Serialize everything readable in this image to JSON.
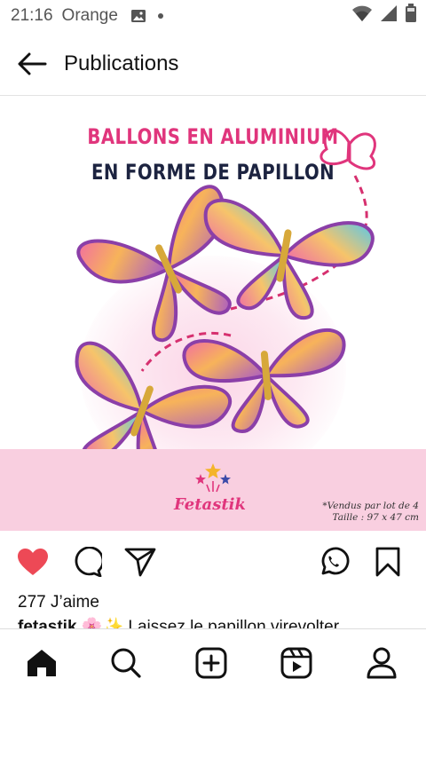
{
  "status_bar": {
    "time": "21:16",
    "carrier": "Orange",
    "icons": [
      "image-icon",
      "dot-icon",
      "wifi-icon",
      "signal-icon",
      "battery-icon"
    ]
  },
  "header": {
    "title": "Publications",
    "back_icon": "arrow-left-icon"
  },
  "post": {
    "image_title_line1": "BALLONS EN ALUMINIUM",
    "image_title_line2": "EN FORME DE PAPILLON",
    "brand": "Fetastik",
    "note_line1": "*Vendus par lot de 4",
    "note_line2": "Taille : 97 x 47 cm",
    "colors": {
      "title_pink": "#e0357c",
      "title_navy": "#1c2340",
      "band_pink": "#f9cfe0"
    }
  },
  "actions": {
    "like_icon": "heart-filled-icon",
    "comment_icon": "comment-icon",
    "share_icon": "send-icon",
    "whatsapp_icon": "whatsapp-icon",
    "save_icon": "bookmark-icon",
    "like_color": "#ed4956"
  },
  "likes_text": "277 J’aime",
  "caption": {
    "username": "fetastik",
    "text": " 🌸✨ Laissez le papillon virevolter"
  },
  "bottom_nav": [
    "home-icon",
    "search-icon",
    "add-icon",
    "reels-icon",
    "profile-icon"
  ]
}
